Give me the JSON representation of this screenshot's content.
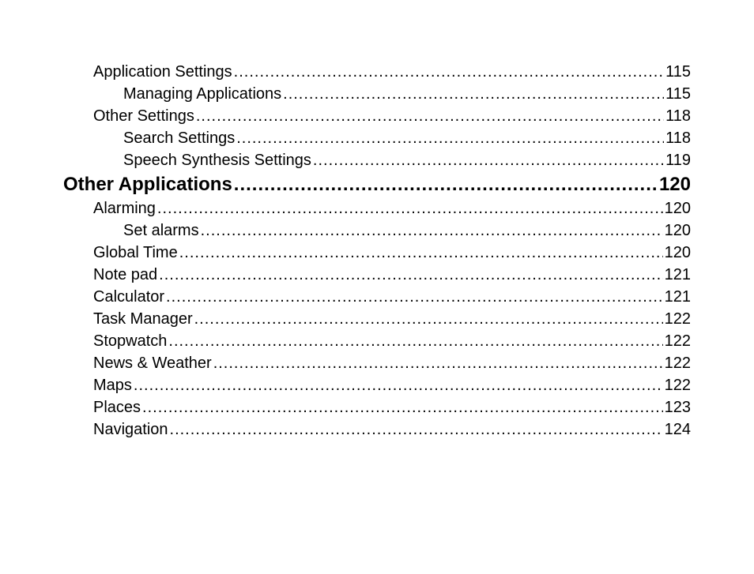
{
  "toc": [
    {
      "level": 1,
      "label": "Application Settings",
      "page": "115"
    },
    {
      "level": 2,
      "label": "Managing Applications",
      "page": "115"
    },
    {
      "level": 1,
      "label": "Other Settings",
      "page": "118"
    },
    {
      "level": 2,
      "label": "Search Settings",
      "page": "118"
    },
    {
      "level": 2,
      "label": "Speech Synthesis Settings",
      "page": "119"
    },
    {
      "level": 0,
      "label": "Other Applications",
      "page": "120"
    },
    {
      "level": 1,
      "label": "Alarming",
      "page": "120"
    },
    {
      "level": 2,
      "label": "Set alarms",
      "page": "120"
    },
    {
      "level": 1,
      "label": "Global Time",
      "page": "120"
    },
    {
      "level": 1,
      "label": "Note pad",
      "page": "121"
    },
    {
      "level": 1,
      "label": "Calculator",
      "page": "121"
    },
    {
      "level": 1,
      "label": "Task Manager",
      "page": "122"
    },
    {
      "level": 1,
      "label": "Stopwatch",
      "page": "122"
    },
    {
      "level": 1,
      "label": "News & Weather",
      "page": "122"
    },
    {
      "level": 1,
      "label": "Maps",
      "page": "122"
    },
    {
      "level": 1,
      "label": "Places",
      "page": "123"
    },
    {
      "level": 1,
      "label": "Navigation",
      "page": "124"
    }
  ]
}
